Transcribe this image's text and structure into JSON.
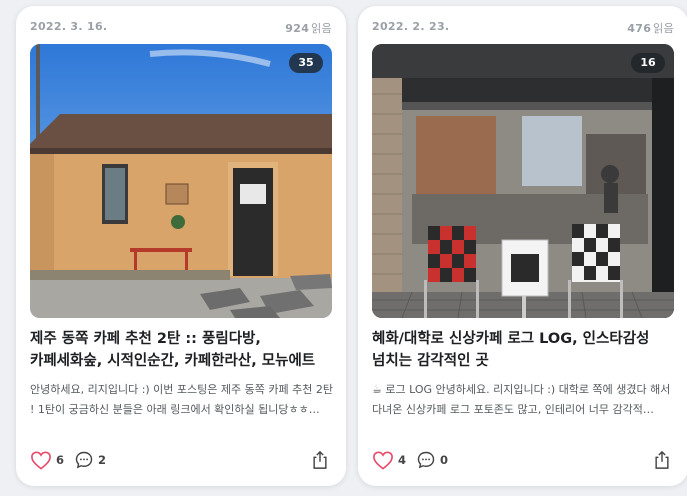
{
  "posts": [
    {
      "date": "2022. 3. 16.",
      "views": "924",
      "views_unit": "읽음",
      "photo_count": "35",
      "title": "제주 동쪽 카페 추천 2탄 :: 풍림다방, 카페세화숲, 시적인순간, 카페한라산, 모뉴에트",
      "excerpt": "안녕하세요, 리지입니다 :) 이번 포스팅은 제주 동쪽 카페 추천 2탄 ! 1탄이 궁금하신 분들은 아래 링크에서 확인하실 됩니당ㅎㅎ…",
      "likes": "6",
      "comments": "2",
      "icons": {
        "like": "heart-icon",
        "comment": "comment-bubble-icon",
        "share": "share-icon"
      }
    },
    {
      "date": "2022. 2. 23.",
      "views": "476",
      "views_unit": "읽음",
      "photo_count": "16",
      "title": "혜화/대학로 신상카페 로그 LOG, 인스타감성 넘치는 감각적인 곳",
      "excerpt": "☕ 로그 LOG 안녕하세요. 리지입니다 :) 대학로 쪽에 생겼다 해서 다녀온 신상카페 로그 포토존도 많고, 인테리어 너무 감각적…",
      "likes": "4",
      "comments": "0",
      "icons": {
        "like": "heart-icon",
        "comment": "comment-bubble-icon",
        "share": "share-icon"
      }
    }
  ],
  "colors": {
    "like": "#e84a6b",
    "text": "#1d1f22",
    "muted": "#9aa0a6",
    "card": "#ffffff"
  }
}
